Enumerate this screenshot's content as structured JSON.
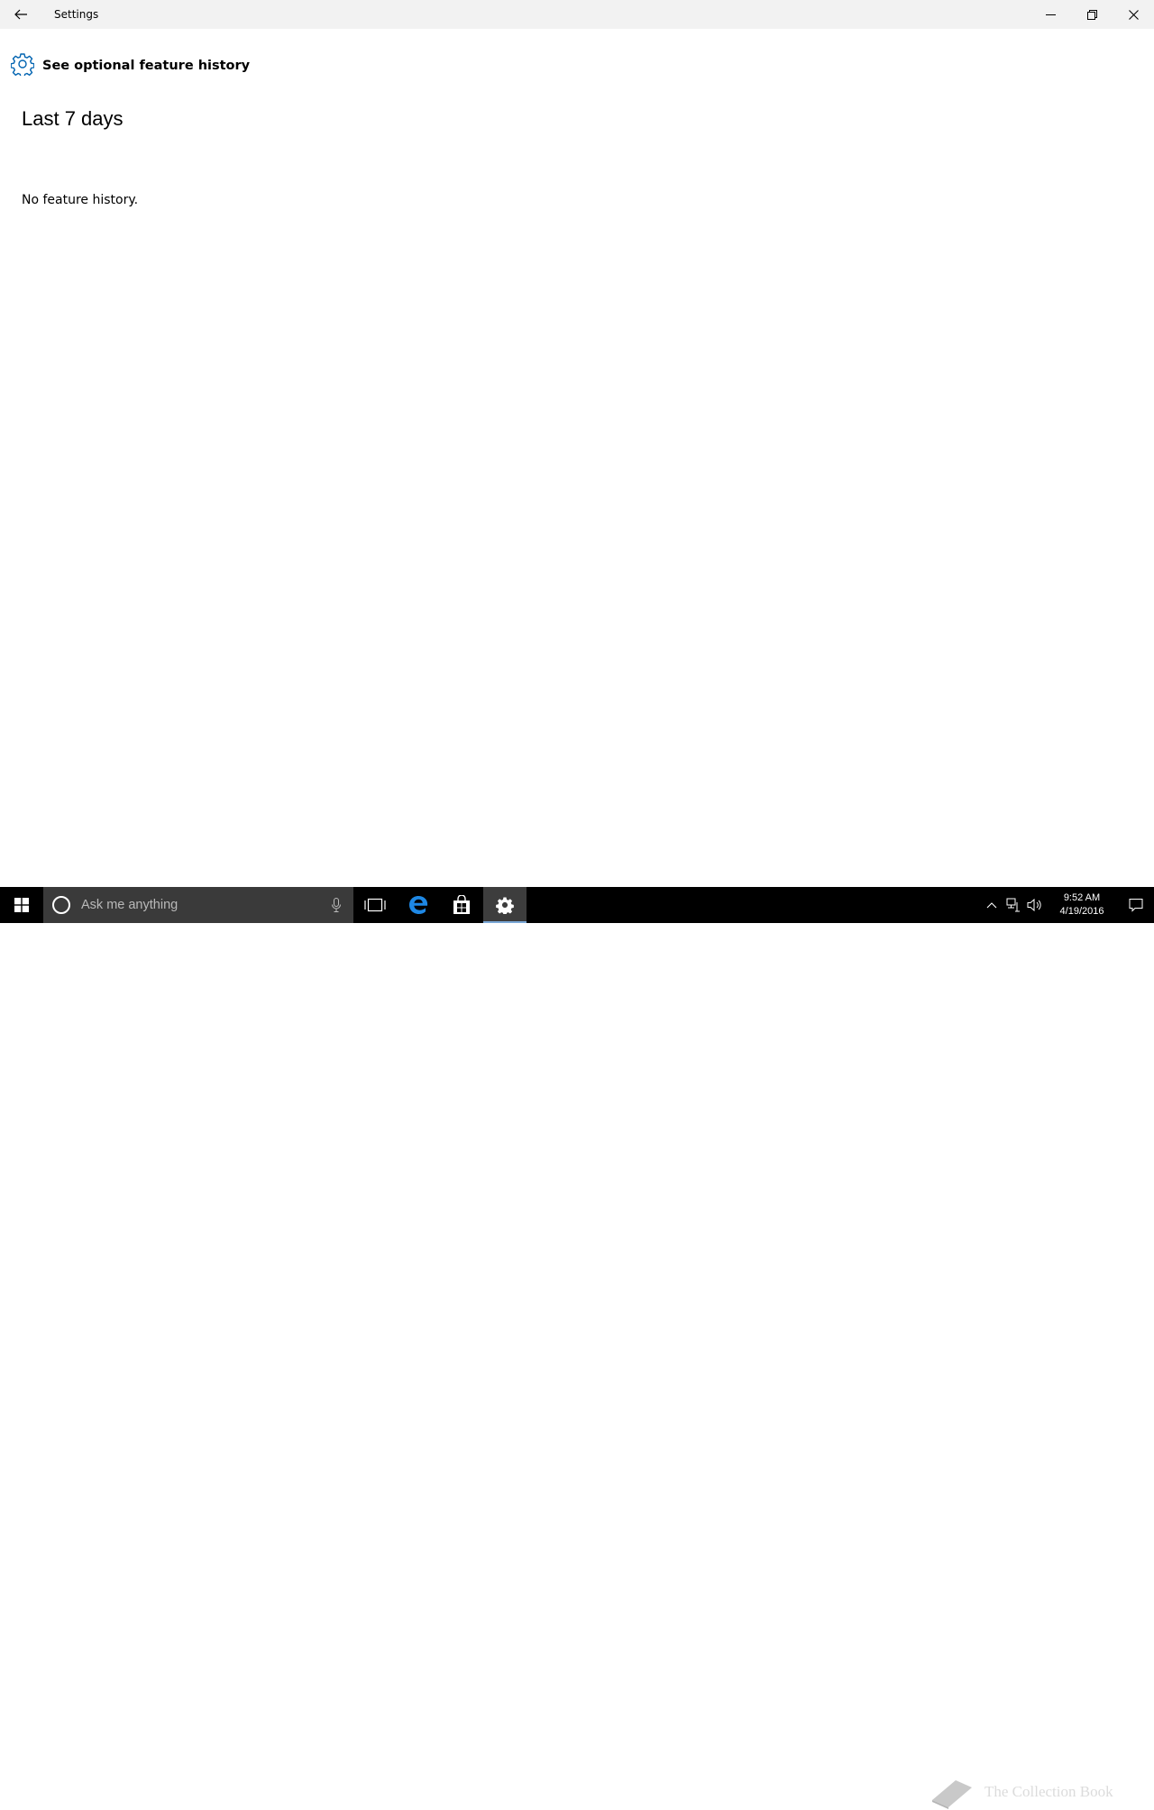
{
  "window": {
    "title": "Settings"
  },
  "page": {
    "title": "See optional feature history",
    "section_title": "Last 7 days",
    "empty_message": "No feature history."
  },
  "taskbar": {
    "search_placeholder": "Ask me anything",
    "clock_time": "9:52 AM",
    "clock_date": "4/19/2016",
    "watermark": "The Collection Book"
  },
  "colors": {
    "accent": "#0063b1",
    "titlebar_bg": "#f2f2f2",
    "taskbar_bg": "#000000",
    "search_bg": "#3a3a3a",
    "active_indicator": "#7aa7d6"
  }
}
